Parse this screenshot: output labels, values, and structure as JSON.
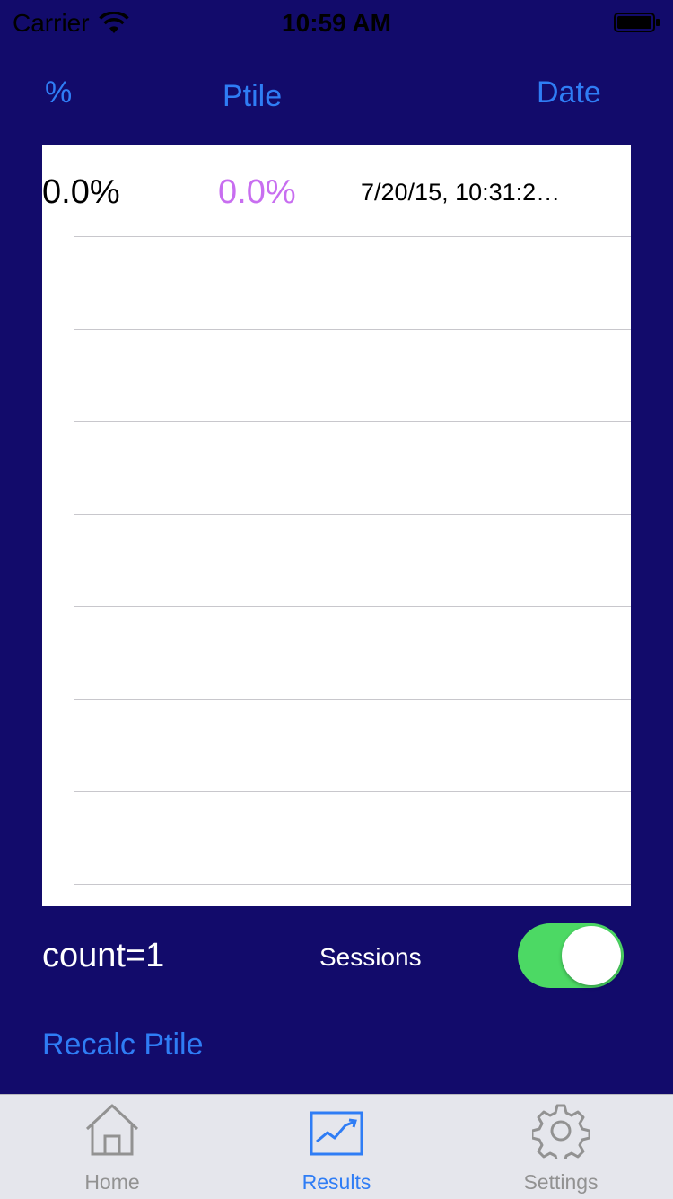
{
  "status_bar": {
    "carrier": "Carrier",
    "time": "10:59 AM"
  },
  "header": {
    "pct_label": "%",
    "ptile_label": "Ptile",
    "date_label": "Date"
  },
  "table": {
    "rows": [
      {
        "pct": "0.0%",
        "ptile": "0.0%",
        "date": "7/20/15, 10:31:2…"
      }
    ]
  },
  "footer": {
    "count": "count=1",
    "sessions_label": "Sessions",
    "sessions_toggle_on": true,
    "recalc_label": "Recalc Ptile"
  },
  "tabbar": {
    "home_label": "Home",
    "results_label": "Results",
    "settings_label": "Settings",
    "selected": "Results"
  },
  "colors": {
    "background": "#120b6b",
    "link": "#2f7df5",
    "ptile_value": "#c86ef0",
    "toggle_on": "#4cd964",
    "tab_inactive": "#929292"
  },
  "icons": {
    "home": "home-icon",
    "results": "chart-trend-icon",
    "settings": "gear-icon",
    "wifi": "wifi-icon",
    "battery": "battery-icon"
  }
}
